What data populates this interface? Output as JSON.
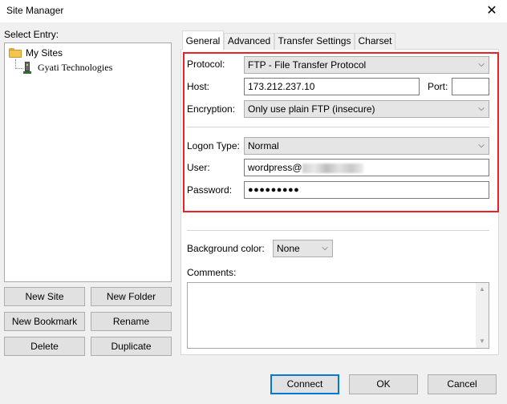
{
  "window": {
    "title": "Site Manager",
    "close_glyph": "✕"
  },
  "left": {
    "select_entry_label": "Select Entry:",
    "tree": {
      "root_label": "My Sites",
      "child_label": "Gyati Technologies"
    },
    "buttons": {
      "new_site": "New Site",
      "new_folder": "New Folder",
      "new_bookmark": "New Bookmark",
      "rename": "Rename",
      "delete": "Delete",
      "duplicate": "Duplicate"
    }
  },
  "tabs": [
    {
      "label": "General",
      "active": true
    },
    {
      "label": "Advanced",
      "active": false
    },
    {
      "label": "Transfer Settings",
      "active": false
    },
    {
      "label": "Charset",
      "active": false
    }
  ],
  "general": {
    "protocol": {
      "label": "Protocol:",
      "value": "FTP - File Transfer Protocol"
    },
    "host": {
      "label": "Host:",
      "value": "173.212.237.10"
    },
    "port": {
      "label": "Port:",
      "value": ""
    },
    "encryption": {
      "label": "Encryption:",
      "value": "Only use plain FTP (insecure)"
    },
    "logon_type": {
      "label": "Logon Type:",
      "value": "Normal"
    },
    "user": {
      "label": "User:",
      "value": "wordpress@"
    },
    "password": {
      "label": "Password:",
      "value": "●●●●●●●●●"
    },
    "background_color": {
      "label": "Background color:",
      "value": "None"
    },
    "comments": {
      "label": "Comments:",
      "value": ""
    }
  },
  "footer": {
    "connect": "Connect",
    "ok": "OK",
    "cancel": "Cancel"
  },
  "colors": {
    "highlight_box": "#e8212b",
    "focus_blue": "#0078d7"
  },
  "icons": [
    "close-icon",
    "folder-icon",
    "server-icon",
    "chevron-down-icon",
    "scroll-up-icon",
    "scroll-down-icon"
  ]
}
